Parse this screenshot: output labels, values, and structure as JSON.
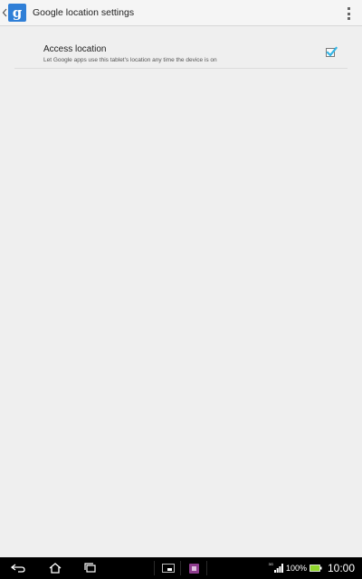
{
  "action_bar": {
    "title": "Google location settings",
    "app_icon_letter": "g",
    "up_icon": "chevron-left-icon",
    "overflow_icon": "overflow-menu-icon"
  },
  "settings": {
    "access_location": {
      "title": "Access location",
      "summary": "Let Google apps use this tablet's location any time the device is on",
      "checked": true
    }
  },
  "system_bar": {
    "nav_buttons": [
      "back-icon",
      "home-icon",
      "recent-apps-icon"
    ],
    "shortcuts": [
      "small-apps-icon",
      "small-app-icon"
    ],
    "signal_label": "3G",
    "battery_percent": "100%",
    "time": "10:00"
  },
  "colors": {
    "accent": "#33b5e5",
    "app_icon_bg": "#2f7fd7",
    "background": "#efefef",
    "battery": "#8fd62b"
  }
}
